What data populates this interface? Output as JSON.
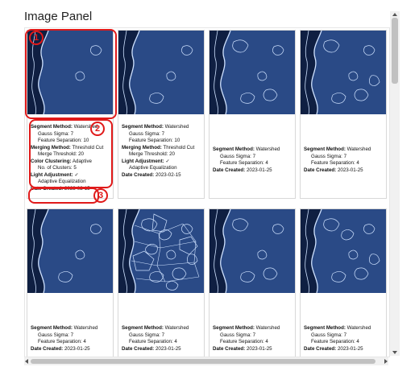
{
  "panel": {
    "title": "Image Panel"
  },
  "annotations": {
    "marker_1": "1",
    "marker_2": "2",
    "marker_3": "3"
  },
  "colors": {
    "thumb_bg": "#2a4a86",
    "thumb_dark": "#0f1f42",
    "segment_line": "#cfe2ff",
    "annotation": "#e01a1a"
  },
  "cards": [
    {
      "variant": 0,
      "lines": [
        {
          "label": "Segment Method:",
          "value": "Watershed",
          "indent": false
        },
        {
          "label": "",
          "value": "Gauss Sigma: 7",
          "indent": true
        },
        {
          "label": "",
          "value": "Feature Separation: 10",
          "indent": true
        },
        {
          "label": "Merging Method:",
          "value": "Threshold Cut",
          "indent": false
        },
        {
          "label": "",
          "value": "Merge Threshold: 20",
          "indent": true
        },
        {
          "label": "Color Clustering:",
          "value": "Adaptive",
          "indent": false
        },
        {
          "label": "",
          "value": "No. of Clusters: 5",
          "indent": true
        },
        {
          "label": "Light Adjustment:",
          "value": "✓",
          "indent": false
        },
        {
          "label": "",
          "value": "Adaptive Equalization",
          "indent": true
        },
        {
          "label": "Date Created:",
          "value": "2023-02-15",
          "indent": false
        }
      ]
    },
    {
      "variant": 1,
      "lines": [
        {
          "label": "Segment Method:",
          "value": "Watershed",
          "indent": false
        },
        {
          "label": "",
          "value": "Gauss Sigma: 7",
          "indent": true
        },
        {
          "label": "",
          "value": "Feature Separation: 10",
          "indent": true
        },
        {
          "label": "Merging Method:",
          "value": "Threshold Cut",
          "indent": false
        },
        {
          "label": "",
          "value": "Merge Threshold: 20",
          "indent": true
        },
        {
          "label": "Light Adjustment:",
          "value": "✓",
          "indent": false
        },
        {
          "label": "",
          "value": "Adaptive Equalization",
          "indent": true
        },
        {
          "label": "Date Created:",
          "value": "2023-02-15",
          "indent": false
        }
      ]
    },
    {
      "variant": 2,
      "lines": [
        {
          "label": "Segment Method:",
          "value": "Watershed",
          "indent": false
        },
        {
          "label": "",
          "value": "Gauss Sigma: 7",
          "indent": true
        },
        {
          "label": "",
          "value": "Feature Separation: 4",
          "indent": true
        },
        {
          "label": "Date Created:",
          "value": "2023-01-25",
          "indent": false
        }
      ]
    },
    {
      "variant": 3,
      "lines": [
        {
          "label": "Segment Method:",
          "value": "Watershed",
          "indent": false
        },
        {
          "label": "",
          "value": "Gauss Sigma: 7",
          "indent": true
        },
        {
          "label": "",
          "value": "Feature Separation: 4",
          "indent": true
        },
        {
          "label": "Date Created:",
          "value": "2023-01-25",
          "indent": false
        }
      ]
    },
    {
      "variant": 4,
      "lines": [
        {
          "label": "Segment Method:",
          "value": "Watershed",
          "indent": false
        },
        {
          "label": "",
          "value": "Gauss Sigma: 7",
          "indent": true
        },
        {
          "label": "",
          "value": "Feature Separation: 4",
          "indent": true
        },
        {
          "label": "Date Created:",
          "value": "2023-01-25",
          "indent": false
        }
      ]
    },
    {
      "variant": 5,
      "lines": [
        {
          "label": "Segment Method:",
          "value": "Watershed",
          "indent": false
        },
        {
          "label": "",
          "value": "Gauss Sigma: 7",
          "indent": true
        },
        {
          "label": "",
          "value": "Feature Separation: 4",
          "indent": true
        },
        {
          "label": "Date Created:",
          "value": "2023-01-25",
          "indent": false
        }
      ]
    },
    {
      "variant": 6,
      "lines": [
        {
          "label": "Segment Method:",
          "value": "Watershed",
          "indent": false
        },
        {
          "label": "",
          "value": "Gauss Sigma: 7",
          "indent": true
        },
        {
          "label": "",
          "value": "Feature Separation: 4",
          "indent": true
        },
        {
          "label": "Date Created:",
          "value": "2023-01-25",
          "indent": false
        }
      ]
    },
    {
      "variant": 7,
      "lines": [
        {
          "label": "Segment Method:",
          "value": "Watershed",
          "indent": false
        },
        {
          "label": "",
          "value": "Gauss Sigma: 7",
          "indent": true
        },
        {
          "label": "",
          "value": "Feature Separation: 4",
          "indent": true
        },
        {
          "label": "Date Created:",
          "value": "2023-01-25",
          "indent": false
        }
      ]
    }
  ]
}
